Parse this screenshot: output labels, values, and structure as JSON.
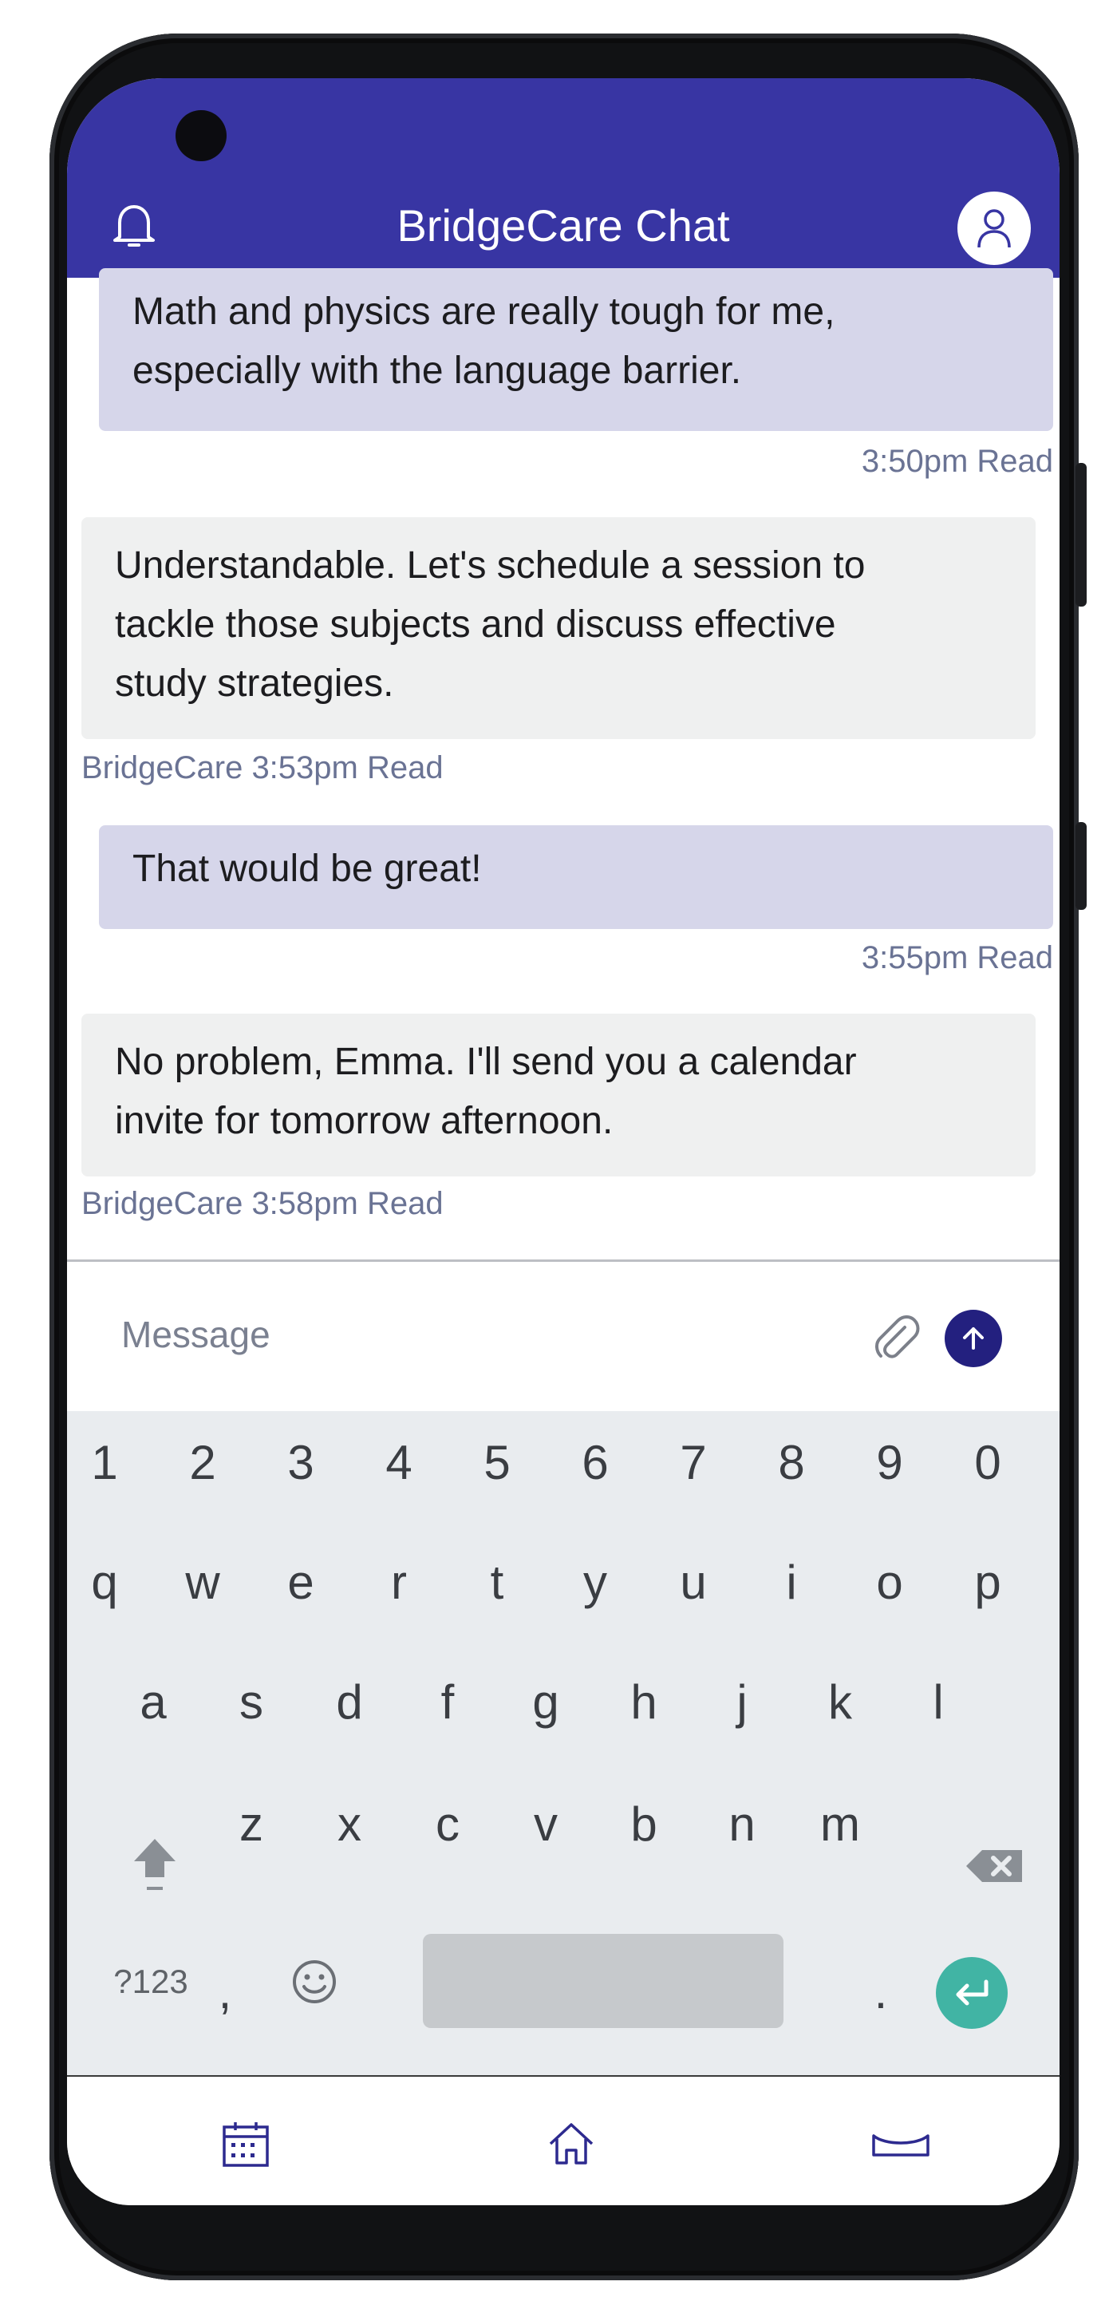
{
  "header": {
    "title": "BridgeCare Chat"
  },
  "messages": [
    {
      "from": "user",
      "text": "Math and physics are really tough for me,\nespecially with the language barrier.",
      "meta": "3:50pm Read"
    },
    {
      "from": "agent",
      "text": "Understandable. Let's schedule a session to\ntackle those subjects and discuss effective\nstudy strategies.",
      "meta": "BridgeCare 3:53pm Read"
    },
    {
      "from": "user",
      "text": "That would be great!",
      "meta": "3:55pm Read"
    },
    {
      "from": "agent",
      "text": "No problem, Emma. I'll send you a calendar\ninvite for tomorrow afternoon.",
      "meta": "BridgeCare 3:58pm Read"
    }
  ],
  "composer": {
    "placeholder": "Message",
    "value": ""
  },
  "keyboard": {
    "row_numbers": [
      "1",
      "2",
      "3",
      "4",
      "5",
      "6",
      "7",
      "8",
      "9",
      "0"
    ],
    "row_top": [
      "q",
      "w",
      "e",
      "r",
      "t",
      "y",
      "u",
      "i",
      "o",
      "p"
    ],
    "row_middle": [
      "a",
      "s",
      "d",
      "f",
      "g",
      "h",
      "j",
      "k",
      "l"
    ],
    "row_bottom": [
      "z",
      "x",
      "c",
      "v",
      "b",
      "n",
      "m"
    ],
    "symbols_key": "?123",
    "comma_key": ",",
    "period_key": "."
  },
  "nav": {
    "icons": [
      "calendar-icon",
      "home-icon",
      "tray-icon"
    ]
  },
  "colors": {
    "header_bg": "#3835a3",
    "user_bubble": "#d6d6ea",
    "agent_bubble": "#eff0f0",
    "meta_text": "#6a7394",
    "send_button": "#23207f",
    "enter_key": "#41b4a4"
  }
}
